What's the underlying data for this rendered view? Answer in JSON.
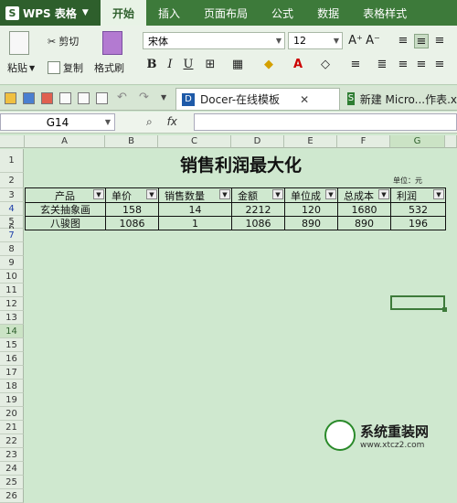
{
  "app": {
    "logo_text": "WPS 表格"
  },
  "menu": {
    "tabs": [
      "开始",
      "插入",
      "页面布局",
      "公式",
      "数据",
      "表格样式"
    ]
  },
  "ribbon": {
    "paste": "粘贴",
    "cut": "剪切",
    "copy": "复制",
    "format_painter": "格式刷",
    "font_name": "宋体",
    "font_size": "12",
    "bold": "B",
    "italic": "I",
    "underline": "U"
  },
  "doc_tabs": [
    {
      "label": "Docer-在线模板",
      "active": true
    },
    {
      "label": "新建 Micro...作表.x"
    }
  ],
  "formula": {
    "cell_ref": "G14",
    "fx": "fx",
    "value": ""
  },
  "columns": [
    "A",
    "B",
    "C",
    "D",
    "E",
    "F",
    "G"
  ],
  "rows": [
    "1",
    "2",
    "3",
    "4",
    "5",
    "6",
    "7",
    "8",
    "9",
    "10",
    "11",
    "12",
    "13",
    "14",
    "15",
    "16",
    "17",
    "18",
    "19",
    "20",
    "21",
    "22",
    "23",
    "24",
    "25",
    "26"
  ],
  "sheet": {
    "title": "销售利润最大化",
    "unit_note": "单位：元",
    "headers": [
      "产品",
      "单价",
      "销售数量",
      "金额",
      "单位成",
      "总成本",
      "利润"
    ],
    "data": [
      [
        "玄关抽象画",
        "158",
        "14",
        "2212",
        "120",
        "1680",
        "532"
      ],
      [
        "八骏图",
        "1086",
        "1",
        "1086",
        "890",
        "890",
        "196"
      ]
    ]
  },
  "watermark": {
    "name": "系统重装网",
    "url": "www.xtcz2.com"
  },
  "colors": {
    "accent": "#3d7a3a",
    "sheet_bg": "#cfe8cf"
  }
}
